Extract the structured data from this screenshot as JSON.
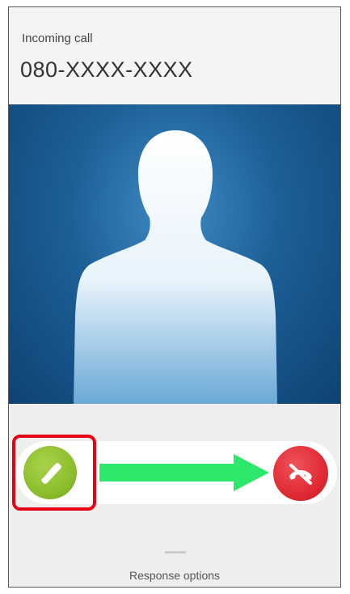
{
  "header": {
    "status_label": "Incoming call",
    "caller_number": "080-XXXX-XXXX"
  },
  "photo": {
    "icon": "person-silhouette-icon"
  },
  "controls": {
    "answer_icon": "phone-icon",
    "decline_icon": "phone-slash-icon",
    "response_options_label": "Response options"
  },
  "colors": {
    "answer": "#8cbf2e",
    "decline": "#e02b33",
    "arrow": "#2ee86b",
    "highlight": "#e60012",
    "photo_background": "#1c5f97"
  }
}
